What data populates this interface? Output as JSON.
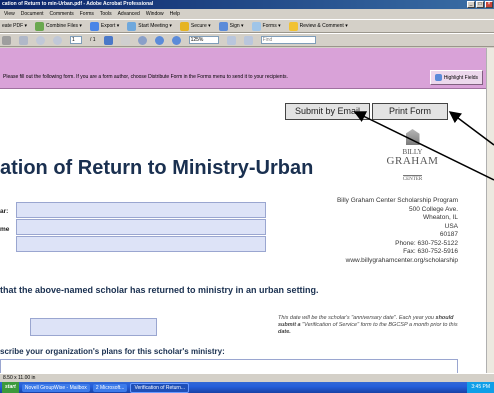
{
  "window": {
    "title": "cation of Return to min-Urban.pdf - Adobe Acrobat Professional"
  },
  "menu": [
    "View",
    "Document",
    "Comments",
    "Forms",
    "Tools",
    "Advanced",
    "Window",
    "Help"
  ],
  "toolbar1": [
    {
      "label": "eate PDF ▾",
      "icon": "create-pdf-icon"
    },
    {
      "label": "Combine Files ▾",
      "icon": "combine-files-icon"
    },
    {
      "label": "Export ▾",
      "icon": "export-icon"
    },
    {
      "label": "Start Meeting ▾",
      "icon": "meeting-icon"
    },
    {
      "label": "Secure ▾",
      "icon": "lock-icon"
    },
    {
      "label": "Sign ▾",
      "icon": "pen-icon"
    },
    {
      "label": "Forms ▾",
      "icon": "forms-icon"
    },
    {
      "label": "Review & Comment ▾",
      "icon": "comment-icon"
    }
  ],
  "toolbar2": {
    "page_current": "1",
    "page_total": "/ 1",
    "zoom": "125%",
    "find_placeholder": "Find"
  },
  "formbar": {
    "message": "Please fill out the following form. If you are a form author, choose Distribute Form in the Forms menu to send it to your recipients.",
    "highlight_label": "Highlight Fields"
  },
  "document": {
    "submit_label": "Submit by Email",
    "print_label": "Print Form",
    "title": "ation of Return to Ministry-Urban",
    "logo": {
      "line1": "BILLY",
      "line2": "GRAHAM",
      "line3": "CENTER"
    },
    "address": [
      "Billy Graham Center Scholarship Program",
      "500 College Ave.",
      "Wheaton, IL",
      "USA",
      "60187",
      "Phone: 630-752-5122",
      "Fax: 630-752-5916",
      "www.billygrahamcenter.org/scholarship"
    ],
    "field_label1": "ar:",
    "field_label2": "me",
    "statement": "that the above-named scholar has returned to ministry in an urban setting.",
    "note_part1": "This date will be the scholar's \"anniversary date\". Each year you ",
    "note_bold1": "should submit a",
    "note_part2": " \"Verification of Service\" form to the BGCSP a month prior to this ",
    "note_bold2": "date.",
    "plans_label": "scribe your organization's plans for this scholar's ministry:"
  },
  "statusbar": {
    "size": "8.50 x 11.00 in"
  },
  "taskbar": {
    "start": "start",
    "tasks": [
      "Novell GroupWise - Mailbox",
      "2 Microsoft...",
      "Verification of Return..."
    ],
    "clock": "3:45 PM"
  }
}
